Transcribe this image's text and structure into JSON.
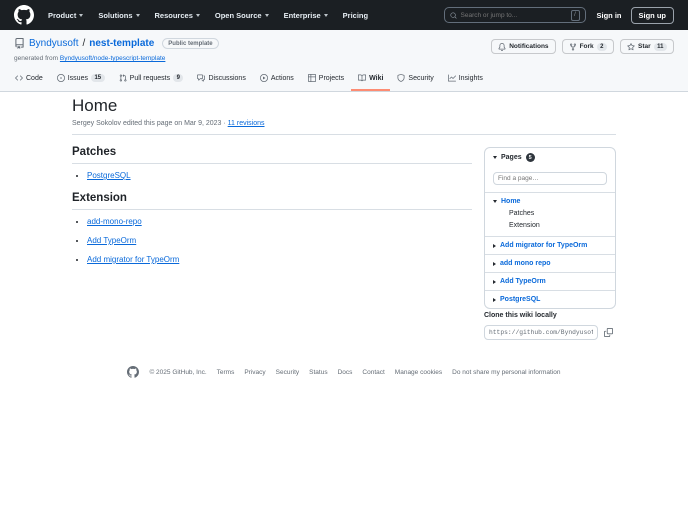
{
  "colors": {
    "header_bg": "#1b1f23",
    "link_blue": "#0969da",
    "active_tab_underline": "#fd8c73",
    "repo_header_bg": "#f6f8fa",
    "border": "#d0d7de",
    "muted_text": "#656d76"
  },
  "top_nav": {
    "menu": [
      "Product",
      "Solutions",
      "Resources",
      "Open Source",
      "Enterprise"
    ],
    "pricing": "Pricing",
    "search_placeholder": "Search or jump to...",
    "slash_key": "/",
    "sign_in": "Sign in",
    "sign_up": "Sign up"
  },
  "repo_header": {
    "owner": "Byndyusoft",
    "separator": "/",
    "name": "nest-template",
    "badge": "Public template",
    "generated_prefix": "generated from",
    "generated_link": "Byndyusoft/node-typescript-template",
    "notifications_label": "Notifications",
    "fork_label": "Fork",
    "fork_count": "2",
    "star_label": "Star",
    "star_count": "11"
  },
  "repo_tabs": [
    {
      "label": "Code"
    },
    {
      "label": "Issues",
      "count": "15"
    },
    {
      "label": "Pull requests",
      "count": "9"
    },
    {
      "label": "Discussions"
    },
    {
      "label": "Actions"
    },
    {
      "label": "Projects"
    },
    {
      "label": "Wiki"
    },
    {
      "label": "Security"
    },
    {
      "label": "Insights"
    }
  ],
  "wiki": {
    "title": "Home",
    "byline_text": "Sergey Sokolov edited this page on Mar 9, 2023 ·",
    "revisions_link": "11 revisions",
    "sections": [
      {
        "heading": "Patches",
        "links": [
          "PostgreSQL"
        ]
      },
      {
        "heading": "Extension",
        "links": [
          "add-mono-repo",
          "Add TypeOrm",
          "Add migrator for TypeOrm"
        ]
      }
    ]
  },
  "sidebar": {
    "pages_label": "Pages",
    "pages_count": "5",
    "find_placeholder": "Find a page…",
    "home": {
      "label": "Home",
      "children": [
        "Patches",
        "Extension"
      ]
    },
    "items": [
      "Add migrator for TypeOrm",
      "add mono repo",
      "Add TypeOrm",
      "PostgreSQL"
    ],
    "clone_heading": "Clone this wiki locally",
    "clone_url": "https://github.com/Byndyusoft/nes"
  },
  "footer": {
    "copyright": "© 2025 GitHub, Inc.",
    "links": [
      "Terms",
      "Privacy",
      "Security",
      "Status",
      "Docs",
      "Contact",
      "Manage cookies",
      "Do not share my personal information"
    ]
  }
}
